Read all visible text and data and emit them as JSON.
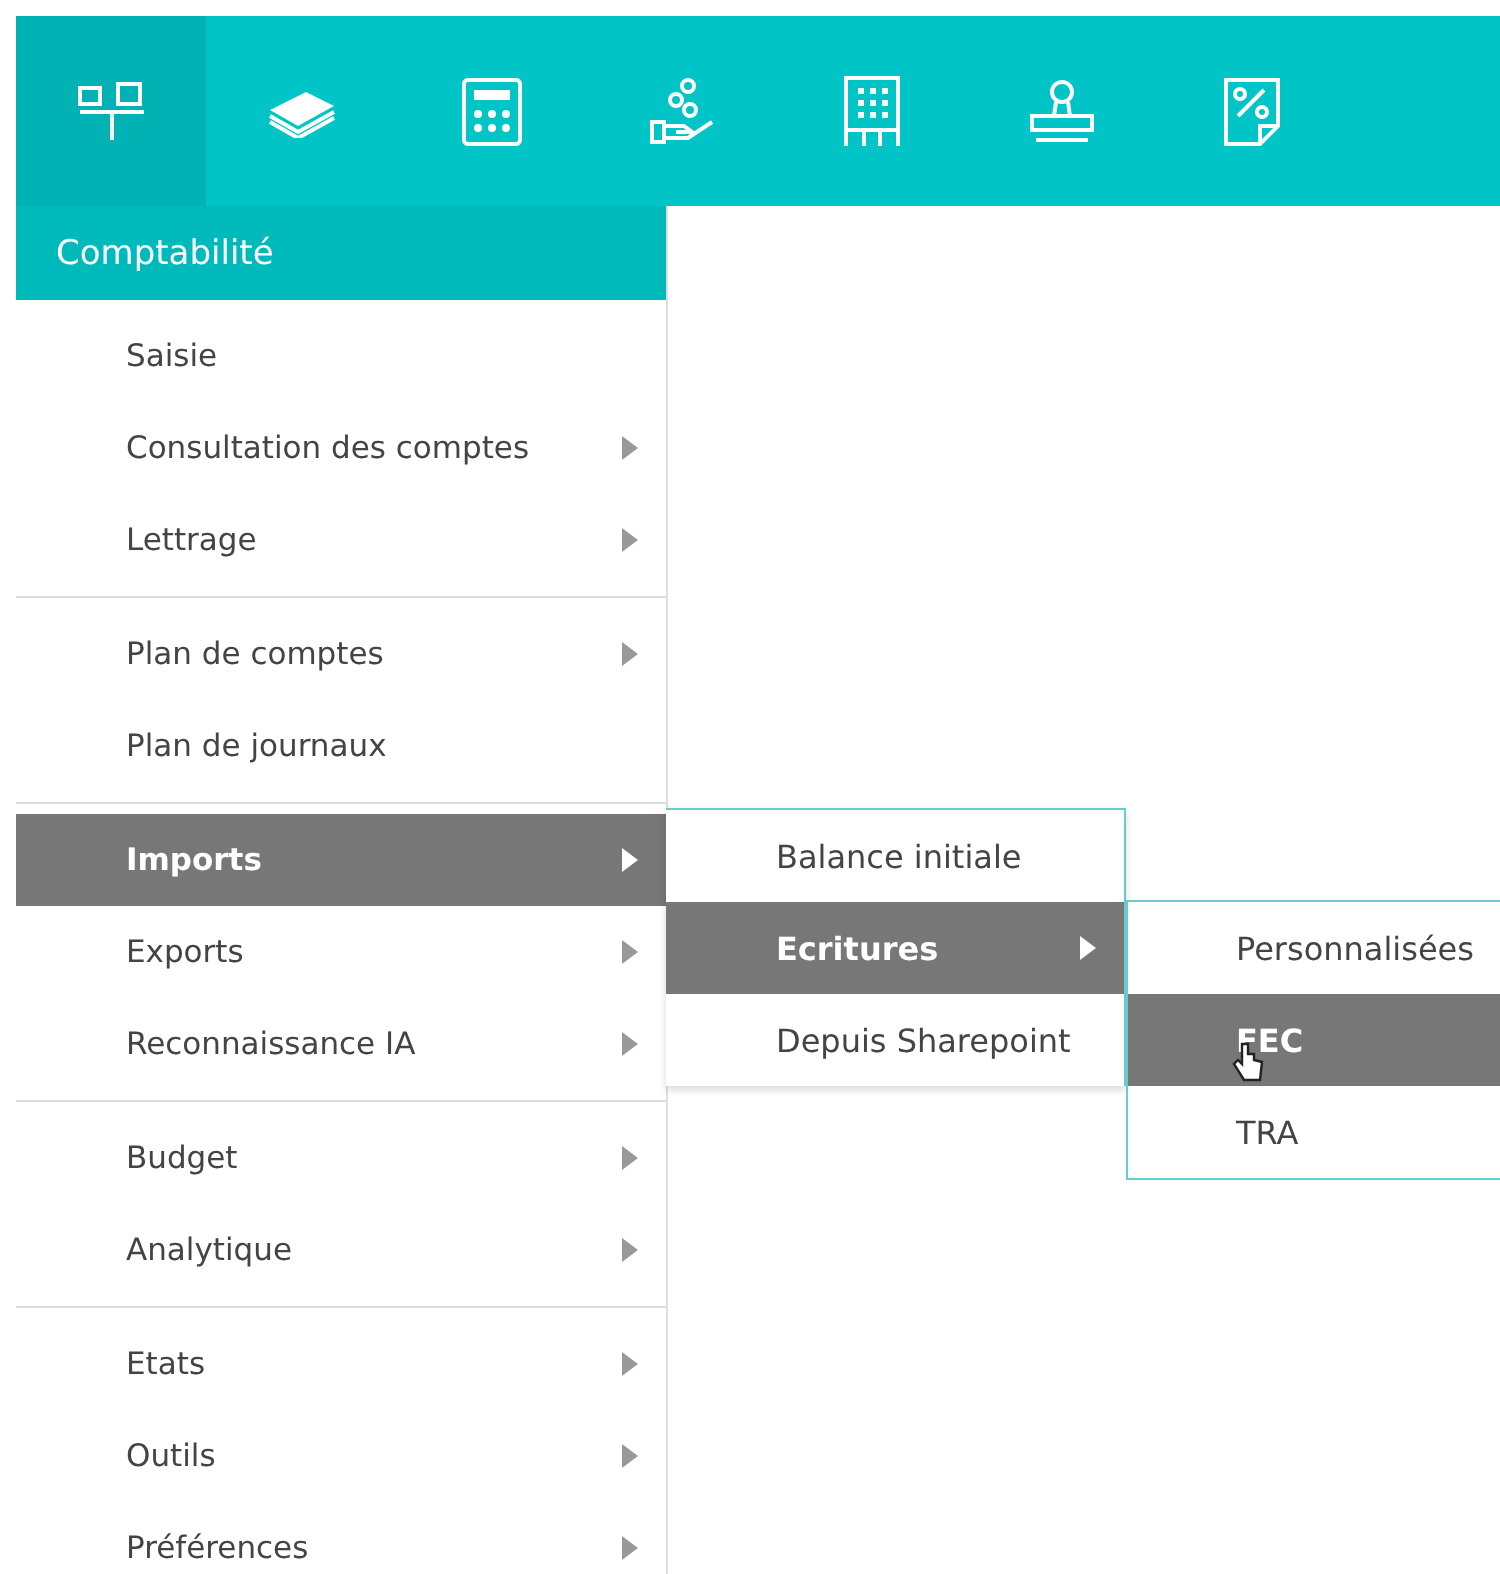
{
  "toolbar": {
    "icons": [
      {
        "kind": "org",
        "selected": true
      },
      {
        "kind": "money",
        "selected": false
      },
      {
        "kind": "calculator",
        "selected": false
      },
      {
        "kind": "coins",
        "selected": false
      },
      {
        "kind": "building",
        "selected": false
      },
      {
        "kind": "stamp",
        "selected": false
      },
      {
        "kind": "percent",
        "selected": false
      }
    ]
  },
  "menu": {
    "title": "Comptabilité",
    "groups": [
      [
        {
          "label": "Saisie",
          "submenu": false,
          "selected": false
        },
        {
          "label": "Consultation des comptes",
          "submenu": true,
          "selected": false
        },
        {
          "label": "Lettrage",
          "submenu": true,
          "selected": false
        }
      ],
      [
        {
          "label": "Plan de comptes",
          "submenu": true,
          "selected": false
        },
        {
          "label": "Plan de journaux",
          "submenu": false,
          "selected": false
        }
      ],
      [
        {
          "label": "Imports",
          "submenu": true,
          "selected": true
        },
        {
          "label": "Exports",
          "submenu": true,
          "selected": false
        },
        {
          "label": "Reconnaissance IA",
          "submenu": true,
          "selected": false
        }
      ],
      [
        {
          "label": "Budget",
          "submenu": true,
          "selected": false
        },
        {
          "label": "Analytique",
          "submenu": true,
          "selected": false
        }
      ],
      [
        {
          "label": "Etats",
          "submenu": true,
          "selected": false
        },
        {
          "label": "Outils",
          "submenu": true,
          "selected": false
        },
        {
          "label": "Préférences",
          "submenu": true,
          "selected": false
        }
      ]
    ]
  },
  "submenu": {
    "items": [
      {
        "label": "Balance initiale",
        "submenu": false,
        "selected": false
      },
      {
        "label": "Ecritures",
        "submenu": true,
        "selected": true
      },
      {
        "label": "Depuis Sharepoint",
        "submenu": false,
        "selected": false
      }
    ]
  },
  "submenu_2": {
    "items": [
      {
        "label": "Personnalisées",
        "selected": false
      },
      {
        "label": "FEC",
        "selected": true
      },
      {
        "label": "TRA",
        "selected": false
      }
    ]
  }
}
